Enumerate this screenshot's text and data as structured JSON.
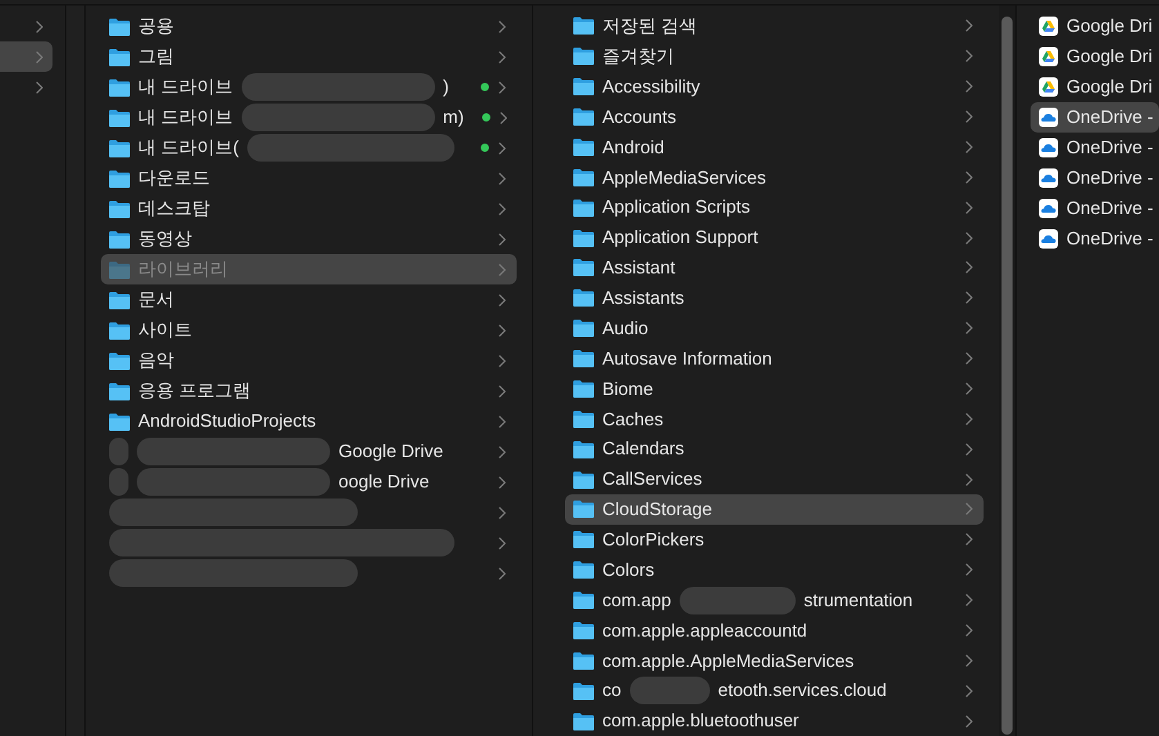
{
  "sidebar": {
    "items": [
      {
        "selected": false
      },
      {
        "selected": true
      },
      {
        "selected": false
      }
    ]
  },
  "columns": [
    {
      "items": [
        {
          "kind": "folder",
          "name": "공용",
          "selected": false,
          "dimmed": false,
          "synced": false
        },
        {
          "kind": "folder",
          "name": "그림",
          "selected": false,
          "dimmed": false,
          "synced": false
        },
        {
          "kind": "partly-hidden",
          "prefix": "내 드라이브",
          "suffix": ")",
          "selected": false,
          "dimmed": false,
          "synced": true
        },
        {
          "kind": "partly-hidden",
          "prefix": "내 드라이브",
          "suffix": "m)",
          "selected": false,
          "dimmed": false,
          "synced": true
        },
        {
          "kind": "partly-hidden",
          "prefix": "내 드라이브(",
          "selected": false,
          "dimmed": false,
          "synced": true
        },
        {
          "kind": "folder",
          "name": "다운로드",
          "selected": false,
          "dimmed": false,
          "synced": false
        },
        {
          "kind": "folder",
          "name": "데스크탑",
          "selected": false,
          "dimmed": false,
          "synced": false
        },
        {
          "kind": "folder",
          "name": "동영상",
          "selected": false,
          "dimmed": false,
          "synced": false
        },
        {
          "kind": "folder",
          "name": "라이브러리",
          "selected": true,
          "dimmed": true,
          "synced": false
        },
        {
          "kind": "folder",
          "name": "문서",
          "selected": false,
          "dimmed": false,
          "synced": false
        },
        {
          "kind": "folder",
          "name": "사이트",
          "selected": false,
          "dimmed": false,
          "synced": false
        },
        {
          "kind": "folder",
          "name": "음악",
          "selected": false,
          "dimmed": false,
          "synced": false
        },
        {
          "kind": "folder",
          "name": "응용 프로그램",
          "selected": false,
          "dimmed": false,
          "synced": false
        },
        {
          "kind": "folder",
          "name": "AndroidStudioProjects",
          "selected": false,
          "dimmed": false,
          "synced": false
        },
        {
          "kind": "partly-hidden",
          "suffix": "Google Drive",
          "selected": false,
          "dimmed": false,
          "synced": false
        },
        {
          "kind": "partly-hidden",
          "suffix": "oogle Drive",
          "selected": false,
          "dimmed": false,
          "synced": false
        },
        {
          "kind": "hidden",
          "selected": false,
          "dimmed": false,
          "synced": false
        },
        {
          "kind": "hidden",
          "selected": false,
          "dimmed": false,
          "synced": false
        },
        {
          "kind": "hidden",
          "selected": false,
          "dimmed": false,
          "synced": false
        }
      ]
    },
    {
      "items": [
        {
          "kind": "folder",
          "name": "저장된 검색",
          "selected": false
        },
        {
          "kind": "folder",
          "name": "즐겨찾기",
          "selected": false
        },
        {
          "kind": "folder",
          "name": "Accessibility",
          "selected": false
        },
        {
          "kind": "folder",
          "name": "Accounts",
          "selected": false
        },
        {
          "kind": "folder",
          "name": "Android",
          "selected": false
        },
        {
          "kind": "folder",
          "name": "AppleMediaServices",
          "selected": false
        },
        {
          "kind": "folder",
          "name": "Application Scripts",
          "selected": false
        },
        {
          "kind": "folder",
          "name": "Application Support",
          "selected": false
        },
        {
          "kind": "folder",
          "name": "Assistant",
          "selected": false
        },
        {
          "kind": "folder",
          "name": "Assistants",
          "selected": false
        },
        {
          "kind": "folder",
          "name": "Audio",
          "selected": false
        },
        {
          "kind": "folder",
          "name": "Autosave Information",
          "selected": false
        },
        {
          "kind": "folder",
          "name": "Biome",
          "selected": false
        },
        {
          "kind": "folder",
          "name": "Caches",
          "selected": false
        },
        {
          "kind": "folder",
          "name": "Calendars",
          "selected": false
        },
        {
          "kind": "folder",
          "name": "CallServices",
          "selected": false
        },
        {
          "kind": "folder",
          "name": "CloudStorage",
          "selected": true
        },
        {
          "kind": "folder",
          "name": "ColorPickers",
          "selected": false
        },
        {
          "kind": "folder",
          "name": "Colors",
          "selected": false
        },
        {
          "kind": "partly-hidden",
          "prefix": "com.app",
          "suffix": "strumentation",
          "selected": false
        },
        {
          "kind": "folder",
          "name": "com.apple.appleaccountd",
          "selected": false
        },
        {
          "kind": "folder",
          "name": "com.apple.AppleMediaServices",
          "selected": false
        },
        {
          "kind": "partly-hidden",
          "prefix": "co",
          "suffix": "etooth.services.cloud",
          "selected": false
        },
        {
          "kind": "folder",
          "name": "com.apple.bluetoothuser",
          "selected": false
        }
      ]
    },
    {
      "items": [
        {
          "kind": "google-drive",
          "name": "Google Dri",
          "selected": false
        },
        {
          "kind": "google-drive",
          "name": "Google Dri",
          "selected": false
        },
        {
          "kind": "google-drive",
          "name": "Google Dri",
          "selected": false
        },
        {
          "kind": "onedrive",
          "name": "OneDrive -",
          "selected": true
        },
        {
          "kind": "onedrive",
          "name": "OneDrive -",
          "selected": false
        },
        {
          "kind": "onedrive",
          "name": "OneDrive -",
          "selected": false
        },
        {
          "kind": "onedrive",
          "name": "OneDrive -",
          "selected": false
        },
        {
          "kind": "onedrive",
          "name": "OneDrive -",
          "selected": false
        }
      ]
    }
  ]
}
